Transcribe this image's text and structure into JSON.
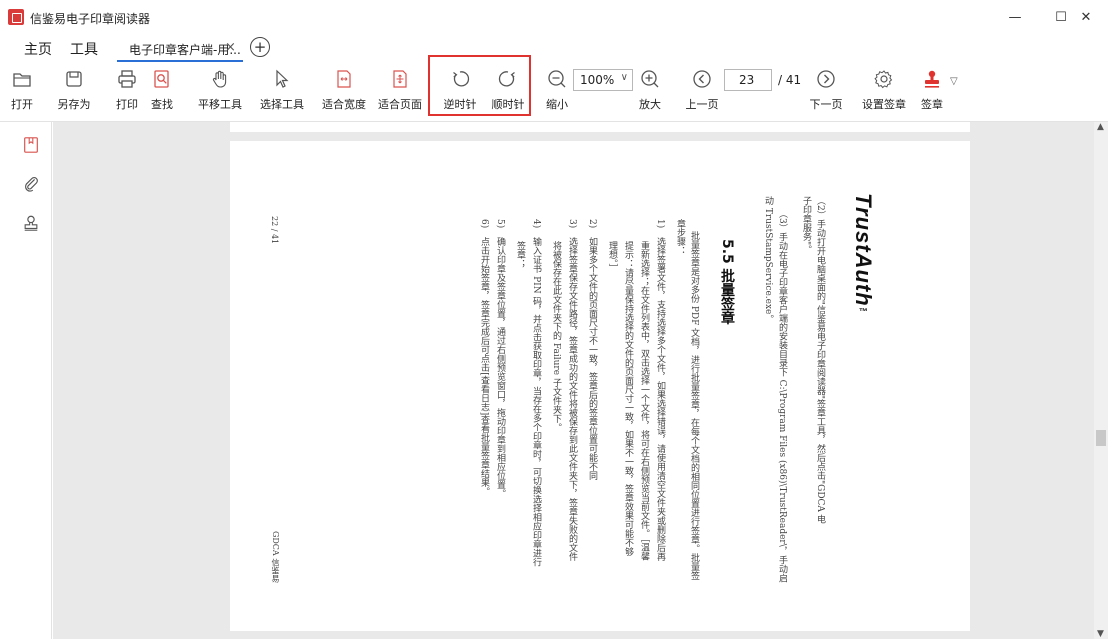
{
  "window": {
    "title": "信鉴易电子印章阅读器",
    "min_glyph": "—",
    "max_glyph": "☐",
    "close_glyph": "✕"
  },
  "menu": {
    "home": "主页",
    "tools": "工具"
  },
  "tab": {
    "label": "电子印章客户端-用...",
    "close_glyph": "×",
    "add_glyph": "+"
  },
  "toolbar": {
    "open": "打开",
    "save_as": "另存为",
    "print": "打印",
    "find": "查找",
    "pan": "平移工具",
    "select": "选择工具",
    "fit_width": "适合宽度",
    "fit_page": "适合页面",
    "rotate_ccw": "逆时针",
    "rotate_cw": "顺时针",
    "zoom_out": "缩小",
    "zoom_value": "100%",
    "zoom_caret": "∨",
    "zoom_in": "放大",
    "prev_page": "上一页",
    "page_current": "23",
    "page_total": "/ 41",
    "next_page": "下一页",
    "sign_settings": "设置签章",
    "sign": "签章",
    "sign_caret": "▽"
  },
  "document": {
    "logo": "TrustAuth",
    "logo_tm": "™",
    "heading": "5.5 批量签章",
    "page_label": "22 / 41",
    "footer": "GDCA 信鉴易",
    "lines": [
      "（2）手动打开电脑桌面的\"信鉴易电子印章阅读器\"签章工具，然后点击\"GDCA 电",
      "子印章服务\"。",
      "（3）手动在电子印章客户端的安装目录下 C:\\Program Files (x86)\\TrustReader\\，手动启",
      "动 TrustStampService.exe。",
      "批量签章是对多份 PDF 文档，进行批量签章，在每个文档的相同位置进行签章。批量签",
      "章步骤：",
      "1)　选择签署文件，支持选择多个文件，如果选择错误，请使用清空文件夹或删除后再",
      "重新选择；在文件列表中，双击选择一个文件，将可在右侧预览当前文件。［温馨",
      "提示：请尽量保持选择的文件的页面尺寸一致，如果不一致，签章效果可能不够",
      "理想。］",
      "2)　如果多个文件的页面尺寸不一致，签章后的签章位置可能不同",
      "3)　选择签章保存文件路径，签章成功的文件将被保存到此文件夹下，签章失败的文件",
      "将被保存在此文件夹下的 Failure 子文件夹下。",
      "4)　输入证书 PIN 码，并点击获取印章，当存在多个印章时，可切换选择相应印章进行",
      "签章；",
      "5)　确认印章及签章位置，通过右侧预览窗口，拖动印章到相应位置。",
      "6)　点击开始签章，签章完成后可点击[查看日志]查看批量签章结果。"
    ]
  }
}
